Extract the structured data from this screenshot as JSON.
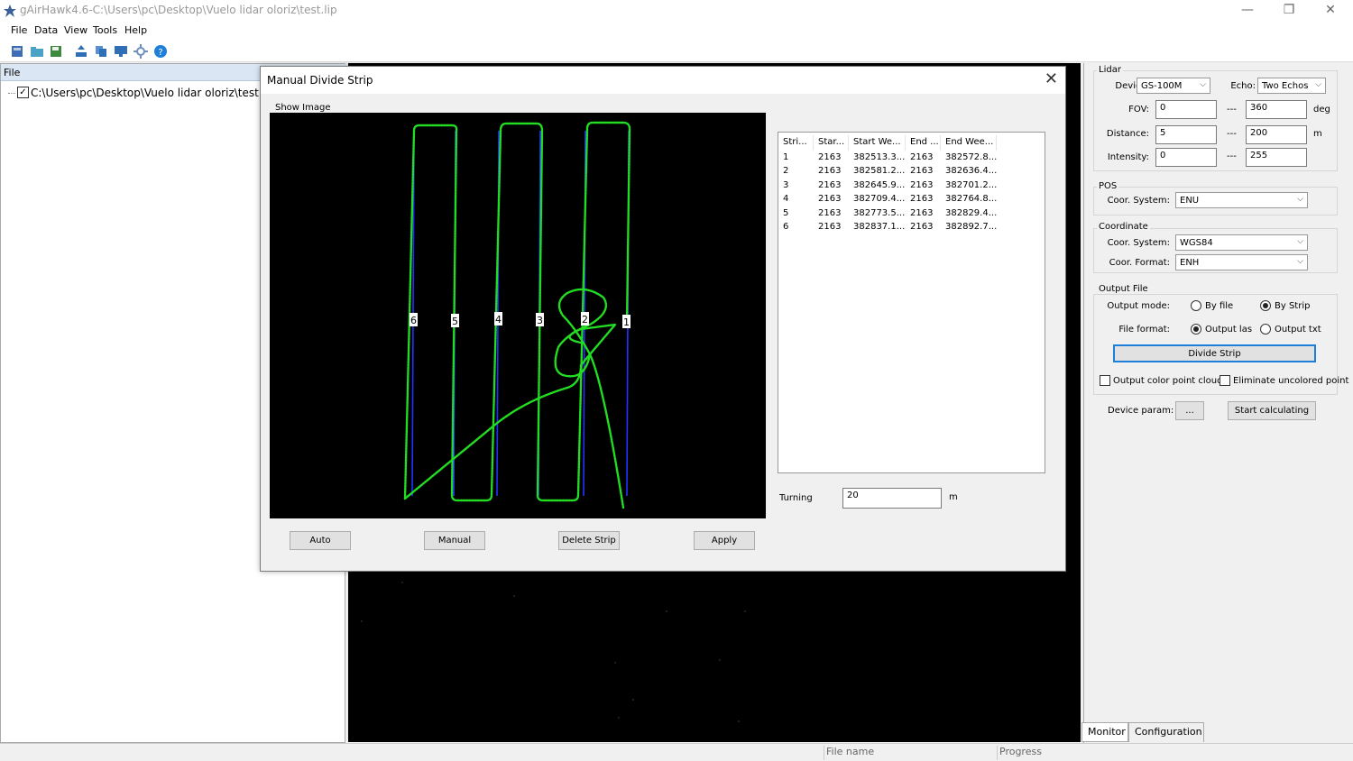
{
  "window": {
    "title": "gAirHawk4.6-C:\\Users\\pc\\Desktop\\Vuelo lidar oloriz\\test.lip",
    "controls": {
      "minimize": "—",
      "maximize": "❐",
      "close": "✕"
    }
  },
  "menu": [
    "File",
    "Data",
    "View",
    "Tools",
    "Help"
  ],
  "toolbar_icons": [
    "new-project-icon",
    "open-icon",
    "save-icon",
    "import-icon",
    "copy-icon",
    "display-icon",
    "settings-icon",
    "help-icon"
  ],
  "left_panel": {
    "header": "File",
    "tree_item": "C:\\Users\\pc\\Desktop\\Vuelo lidar oloriz\\testLIVLin",
    "checked_mark": "✓"
  },
  "dialog": {
    "title": "Manual Divide Strip",
    "close": "✕",
    "show_image_label": "Show Image",
    "strip_labels": [
      "6",
      "5",
      "4",
      "3",
      "2",
      "1"
    ],
    "table": {
      "columns": [
        "Stri...",
        "Star...",
        "Start We...",
        "End ...",
        "End Wee..."
      ],
      "rows": [
        [
          "1",
          "2163",
          "382513.3...",
          "2163",
          "382572.8..."
        ],
        [
          "2",
          "2163",
          "382581.2...",
          "2163",
          "382636.4..."
        ],
        [
          "3",
          "2163",
          "382645.9...",
          "2163",
          "382701.2..."
        ],
        [
          "4",
          "2163",
          "382709.4...",
          "2163",
          "382764.8..."
        ],
        [
          "5",
          "2163",
          "382773.5...",
          "2163",
          "382829.4..."
        ],
        [
          "6",
          "2163",
          "382837.1...",
          "2163",
          "382892.7..."
        ]
      ]
    },
    "turning_label": "Turning",
    "turning_value": "20",
    "turning_unit": "m",
    "buttons": {
      "auto": "Auto",
      "manual": "Manual",
      "delete": "Delete Strip",
      "apply": "Apply"
    },
    "colors": {
      "track": "#22dd22",
      "trajectory": "#2233ff"
    }
  },
  "config": {
    "lidar": {
      "group": "Lidar",
      "device_label": "Device:",
      "device_value": "GS-100M",
      "echo_label": "Echo:",
      "echo_value": "Two Echos",
      "fov_label": "FOV:",
      "fov_min": "0",
      "fov_max": "360",
      "fov_unit": "deg",
      "distance_label": "Distance:",
      "distance_min": "5",
      "distance_max": "200",
      "distance_unit": "m",
      "intensity_label": "Intensity:",
      "intensity_min": "0",
      "intensity_max": "255",
      "sep": "---"
    },
    "pos": {
      "group": "POS",
      "coor_label": "Coor. System:",
      "coor_value": "ENU"
    },
    "coordinate": {
      "group": "Coordinate",
      "system_label": "Coor. System:",
      "system_value": "WGS84",
      "format_label": "Coor. Format:",
      "format_value": "ENH"
    },
    "output": {
      "group": "Output File",
      "mode_label": "Output mode:",
      "by_file": "By file",
      "by_strip": "By Strip",
      "format_label": "File format:",
      "output_las": "Output las",
      "output_txt": "Output txt",
      "divide_button": "Divide Strip",
      "color_clouds": "Output color point clouds",
      "eliminate": "Eliminate uncolored point"
    },
    "device_param_label": "Device param:",
    "device_param_button": "...",
    "start_button": "Start calculating"
  },
  "tabs": [
    "Monitor",
    "Configuration"
  ],
  "status": {
    "file_name": "File name",
    "progress": "Progress"
  }
}
